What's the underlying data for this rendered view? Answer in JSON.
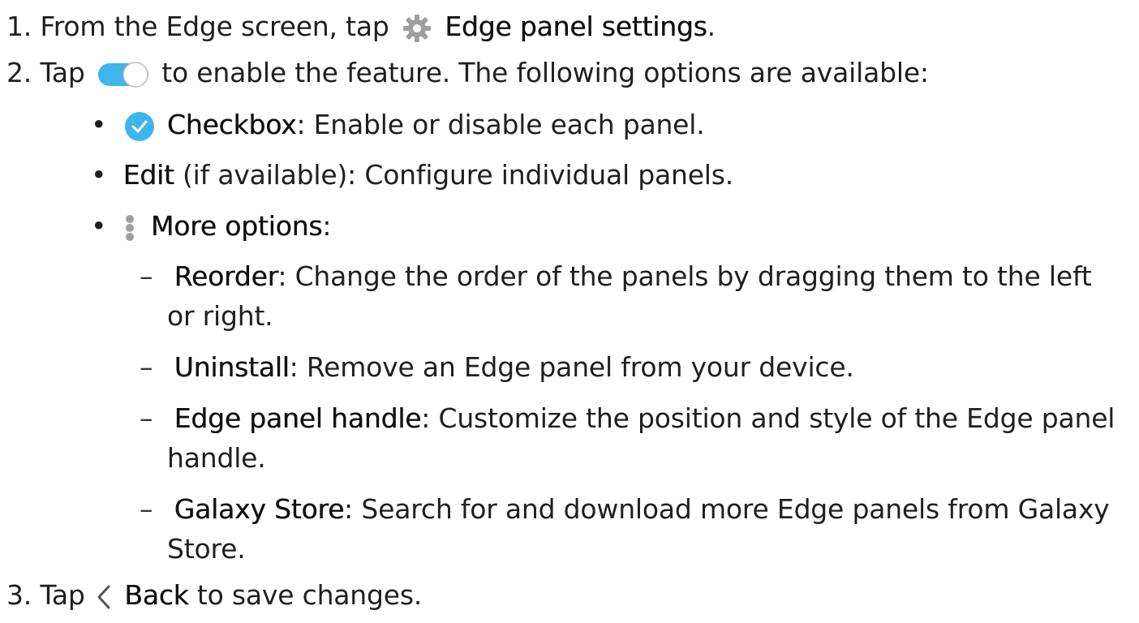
{
  "steps": {
    "s1": {
      "num": "1.",
      "pre": "From the Edge screen, tap",
      "bold": "Edge panel settings",
      "post": "."
    },
    "s2": {
      "num": "2.",
      "pre": "Tap",
      "post": "to enable the feature. The following options are available:"
    },
    "s3": {
      "num": "3.",
      "pre": "Tap",
      "bold": "Back",
      "post": "to save changes."
    }
  },
  "options": {
    "checkbox": {
      "bullet": "•",
      "bold": "Checkbox",
      "text": ": Enable or disable each panel."
    },
    "edit": {
      "bullet": "•",
      "bold": "Edit",
      "text": "(if available): Configure individual panels."
    },
    "more": {
      "bullet": "•",
      "bold": "More options",
      "text": ":"
    }
  },
  "more_options": {
    "reorder": {
      "dash": "–",
      "bold": "Reorder",
      "text": ": Change the order of the panels by dragging them to the left",
      "text2": "or right."
    },
    "uninstall": {
      "dash": "–",
      "bold": "Uninstall",
      "text": ": Remove an Edge panel from your device."
    },
    "handle": {
      "dash": "–",
      "bold": "Edge panel handle",
      "text": ": Customize the position and style of the Edge panel",
      "text2": "handle."
    },
    "store": {
      "dash": "–",
      "bold": "Galaxy Store",
      "text": ": Search for and download more Edge panels from Galaxy",
      "text2": "Store."
    }
  },
  "icons": {
    "settings": "gear-icon",
    "toggle": "toggle-switch-icon",
    "checkbox": "checkmark-circle-icon",
    "more": "vertical-dots-icon",
    "back": "chevron-left-icon"
  },
  "colors": {
    "accent": "#3eb6ec",
    "icon_gray": "#9e9e9e",
    "text": "#1f1f1f"
  }
}
